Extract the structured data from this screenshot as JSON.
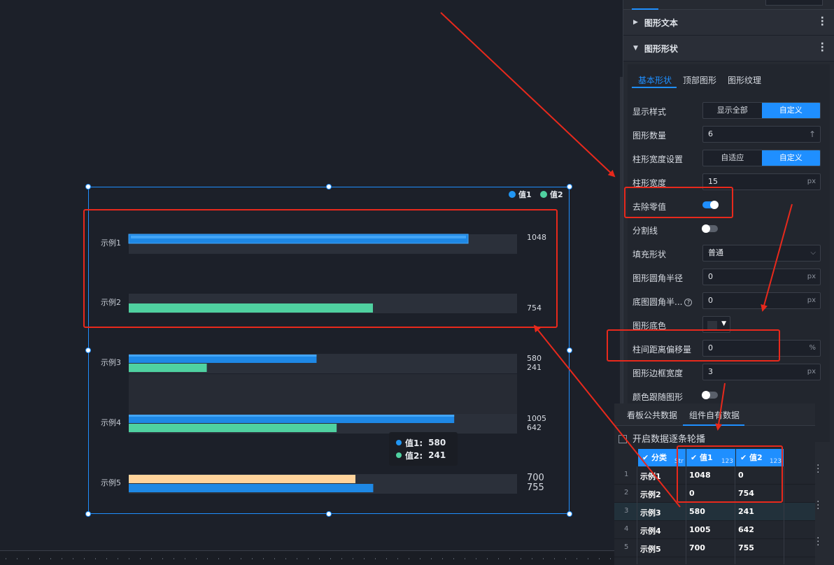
{
  "chart_data": {
    "type": "bar",
    "orientation": "horizontal",
    "categories": [
      "示例1",
      "示例2",
      "示例3",
      "示例4",
      "示例5"
    ],
    "series": [
      {
        "name": "值1",
        "values": [
          1048,
          0,
          580,
          1005,
          700
        ]
      },
      {
        "name": "值2",
        "values": [
          0,
          754,
          241,
          642,
          755
        ]
      }
    ],
    "value_labels": [
      [
        "1048"
      ],
      [
        "754"
      ],
      [
        "580",
        "241"
      ],
      [
        "1005",
        "642"
      ],
      [
        "700",
        "755"
      ]
    ],
    "legend": [
      {
        "name": "值1",
        "color": "#2196f3"
      },
      {
        "name": "值2",
        "color": "#4fd1a0"
      }
    ],
    "legend_position": "top-right",
    "xlim": [
      0,
      1048
    ],
    "colors": {
      "series1": "#1e88e5",
      "series1_highlight": "#42a5f5",
      "series2": "#4fd1a0",
      "track": "#2b303a",
      "example5_bar1": "#ffd39b"
    }
  },
  "tooltip": {
    "rows": [
      {
        "label": "值1:",
        "value": "580"
      },
      {
        "label": "值2:",
        "value": "241"
      }
    ]
  },
  "panel": {
    "sections": [
      {
        "label": "图形文本",
        "expanded": false
      },
      {
        "label": "图形形状",
        "expanded": true
      }
    ],
    "subtabs": [
      {
        "label": "基本形状",
        "active": true
      },
      {
        "label": "顶部图形"
      },
      {
        "label": "图形纹理"
      }
    ],
    "fields": {
      "display_style": {
        "label": "显示样式",
        "options": [
          "显示全部",
          "自定义"
        ],
        "selected": "自定义"
      },
      "shape_count": {
        "label": "图形数量",
        "value": "6"
      },
      "bar_width_setting": {
        "label": "柱形宽度设置",
        "options": [
          "自适应",
          "自定义"
        ],
        "selected": "自定义"
      },
      "bar_width": {
        "label": "柱形宽度",
        "value": "15",
        "unit": "px"
      },
      "remove_zero": {
        "label": "去除零值",
        "on": true
      },
      "divider": {
        "label": "分割线",
        "on": false
      },
      "fill_shape": {
        "label": "填充形状",
        "value": "普通"
      },
      "corner_radius": {
        "label": "图形圆角半径",
        "value": "0",
        "unit": "px"
      },
      "base_radius": {
        "label": "底图圆角半...",
        "value": "0",
        "unit": "px"
      },
      "base_color": {
        "label": "图形底色"
      },
      "bar_gap_offset": {
        "label": "柱间距离偏移量",
        "value": "0",
        "unit": "%"
      },
      "border_width": {
        "label": "图形边框宽度",
        "value": "3",
        "unit": "px"
      },
      "color_follow": {
        "label": "颜色跟随图形",
        "on": false
      }
    }
  },
  "data_panel": {
    "tabs": [
      {
        "label": "看板公共数据"
      },
      {
        "label": "组件自有数据",
        "active": true
      }
    ],
    "carousel_label": "开启数据逐条轮播",
    "columns": [
      {
        "label": "分类",
        "type_tag": "Str"
      },
      {
        "label": "值1",
        "type_tag": "123"
      },
      {
        "label": "值2",
        "type_tag": "123"
      }
    ],
    "rows": [
      {
        "n": "1",
        "cat": "示例1",
        "v1": "1048",
        "v2": "0"
      },
      {
        "n": "2",
        "cat": "示例2",
        "v1": "0",
        "v2": "754"
      },
      {
        "n": "3",
        "cat": "示例3",
        "v1": "580",
        "v2": "241"
      },
      {
        "n": "4",
        "cat": "示例4",
        "v1": "1005",
        "v2": "642"
      },
      {
        "n": "5",
        "cat": "示例5",
        "v1": "700",
        "v2": "755"
      }
    ]
  },
  "annotation_color": "#e8291c",
  "accent_color": "#1f8fff"
}
